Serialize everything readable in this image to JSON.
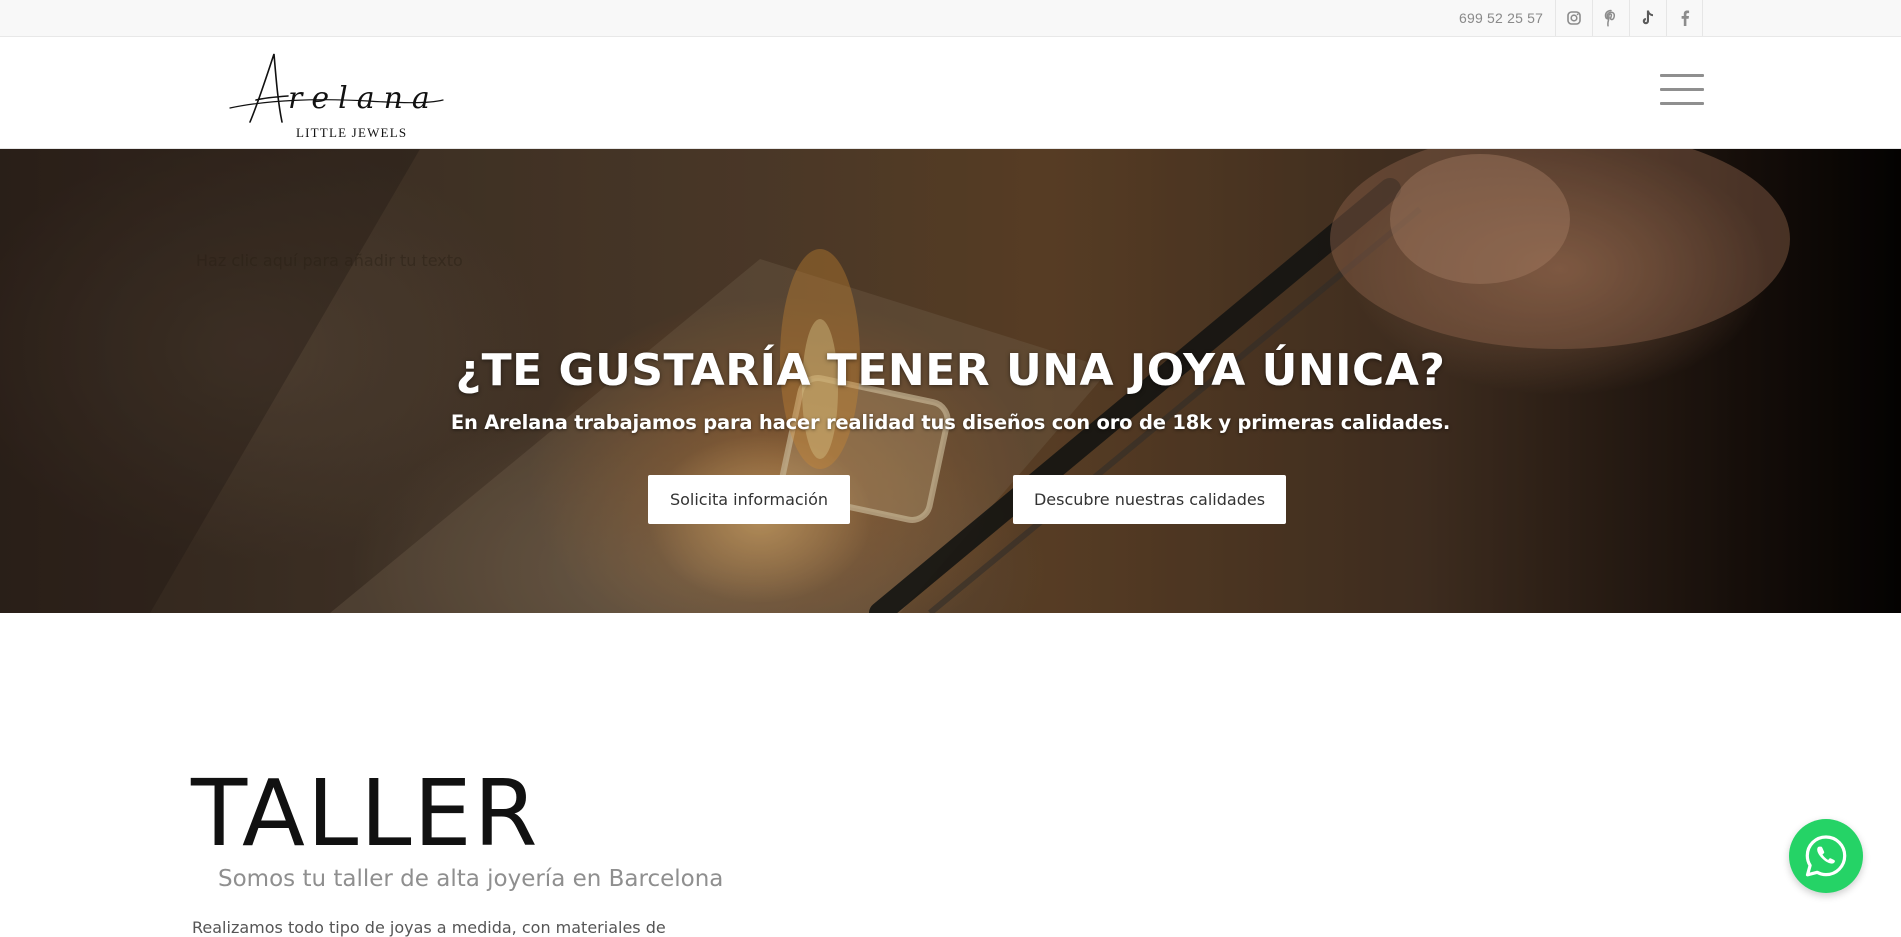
{
  "topbar": {
    "phone": "699 52 25 57",
    "social_icons": [
      "instagram-icon",
      "pinterest-icon",
      "tiktok-icon",
      "facebook-icon"
    ]
  },
  "header": {
    "logo_script": "Arelana",
    "logo_tagline": "LITTLE JEWELS",
    "menu_icon": "hamburger-menu-icon"
  },
  "hero": {
    "faint_text": "Haz clic aquí para añadir tu texto",
    "title": "¿TE GUSTARÍA TENER UNA JOYA ÚNICA?",
    "subtitle": "En Arelana trabajamos para hacer realidad tus diseños con oro de 18k y primeras calidades.",
    "buttons": [
      "Solicita información",
      "Descubre nuestras calidades"
    ]
  },
  "section": {
    "title": "TALLER",
    "subtitle": "Somos tu taller de alta joyería en Barcelona",
    "body_start": "Realizamos todo tipo de joyas a medida, con materiales de"
  },
  "floating": {
    "whatsapp_icon": "whatsapp-icon",
    "color": "#25d366"
  }
}
